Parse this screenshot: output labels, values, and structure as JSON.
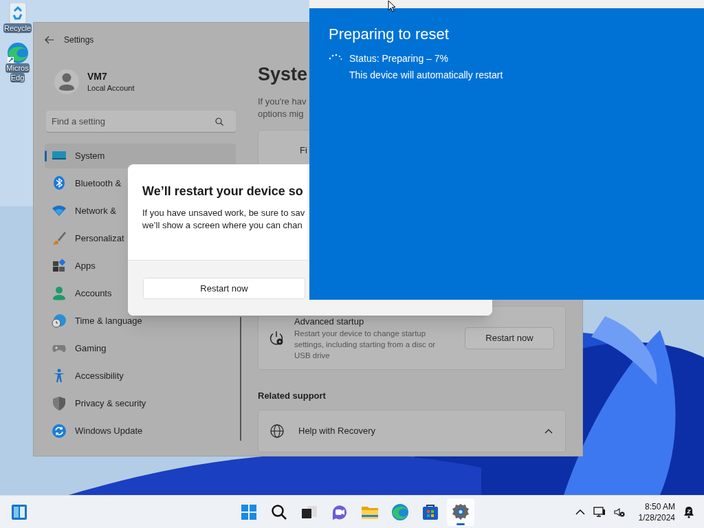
{
  "desktop_icons": [
    {
      "kind": "recycle",
      "lines": [
        "Recycle"
      ]
    },
    {
      "kind": "edge",
      "lines": [
        "Micros",
        "Edg"
      ]
    }
  ],
  "settings": {
    "title": "Settings",
    "account": {
      "name": "VM7",
      "type": "Local Account"
    },
    "search": {
      "placeholder": "Find a setting"
    },
    "nav": [
      {
        "kind": "system",
        "label": "System",
        "selected": true
      },
      {
        "kind": "bluetooth",
        "label": "Bluetooth &",
        "selected": false
      },
      {
        "kind": "network",
        "label": "Network &",
        "selected": false
      },
      {
        "kind": "brush",
        "label": "Personalizat",
        "selected": false
      },
      {
        "kind": "apps",
        "label": "Apps",
        "selected": false
      },
      {
        "kind": "accounts",
        "label": "Accounts",
        "selected": false
      },
      {
        "kind": "time",
        "label": "Time & language",
        "selected": false
      },
      {
        "kind": "gaming",
        "label": "Gaming",
        "selected": false
      },
      {
        "kind": "accessibility",
        "label": "Accessibility",
        "selected": false
      },
      {
        "kind": "privacy",
        "label": "Privacy & security",
        "selected": false
      },
      {
        "kind": "update",
        "label": "Windows Update",
        "selected": false
      }
    ],
    "heading": "Syste",
    "intro_lines": [
      "If you're hav",
      "options mig"
    ],
    "card_label": "Fi",
    "advanced_startup": {
      "title": "Advanced startup",
      "description": "Restart your device to change startup settings, including starting from a disc or USB drive",
      "button": "Restart now"
    },
    "related_support": "Related support",
    "help": {
      "label": "Help with Recovery",
      "expanded": true
    }
  },
  "dialog": {
    "title": "We’ll restart your device so",
    "body_lines": [
      "If you have unsaved work, be sure to sav",
      "we’ll show a screen where you can chan"
    ],
    "button": "Restart now"
  },
  "reset_window": {
    "heading": "Preparing to reset",
    "status": "Status: Preparing – 7%",
    "note": "This device will automatically restart"
  },
  "taskbar": {
    "apps": [
      {
        "kind": "start",
        "selected": false
      },
      {
        "kind": "search",
        "selected": false
      },
      {
        "kind": "taskview",
        "selected": false
      },
      {
        "kind": "chat",
        "selected": false
      },
      {
        "kind": "explorer",
        "selected": false
      },
      {
        "kind": "edge",
        "selected": false
      },
      {
        "kind": "store",
        "selected": false
      },
      {
        "kind": "settings",
        "selected": true
      }
    ],
    "time": "8:50 AM",
    "date": "1/28/2024"
  }
}
